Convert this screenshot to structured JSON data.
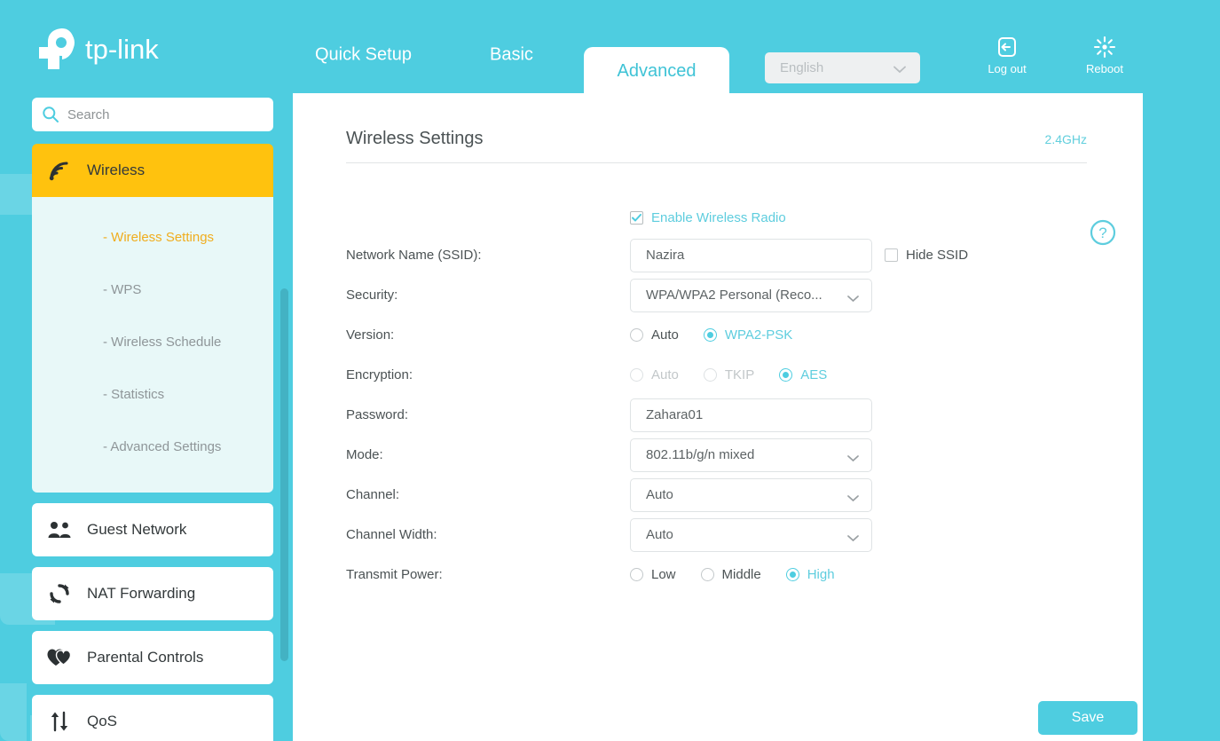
{
  "brand": {
    "name": "tp-link"
  },
  "header": {
    "tabs": [
      {
        "label": "Quick Setup",
        "active": false
      },
      {
        "label": "Basic",
        "active": false
      },
      {
        "label": "Advanced",
        "active": true
      }
    ],
    "language": {
      "value": "English"
    },
    "logout_label": "Log out",
    "reboot_label": "Reboot"
  },
  "sidebar": {
    "search_placeholder": "Search",
    "search_value": "",
    "items": [
      {
        "label": "Wireless",
        "icon": "wifi-icon",
        "active": true
      },
      {
        "label": "Guest Network",
        "icon": "guests-icon",
        "active": false
      },
      {
        "label": "NAT Forwarding",
        "icon": "refresh-icon",
        "active": false
      },
      {
        "label": "Parental Controls",
        "icon": "hearts-icon",
        "active": false
      },
      {
        "label": "QoS",
        "icon": "updown-arrows-icon",
        "active": false
      }
    ],
    "submenu": [
      {
        "label": "- Wireless Settings",
        "selected": true
      },
      {
        "label": "- WPS",
        "selected": false
      },
      {
        "label": "- Wireless Schedule",
        "selected": false
      },
      {
        "label": "- Statistics",
        "selected": false
      },
      {
        "label": "- Advanced Settings",
        "selected": false
      }
    ]
  },
  "page": {
    "title": "Wireless Settings",
    "band": "2.4GHz",
    "help_icon": "question-circle-icon"
  },
  "form": {
    "enable_radio": {
      "label": "Enable Wireless Radio",
      "checked": true
    },
    "ssid": {
      "label": "Network Name (SSID):",
      "value": "Nazira"
    },
    "hide_ssid": {
      "label": "Hide SSID",
      "checked": false
    },
    "security": {
      "label": "Security:",
      "value": "WPA/WPA2 Personal (Reco..."
    },
    "version": {
      "label": "Version:",
      "options": [
        {
          "label": "Auto",
          "selected": false,
          "disabled": false
        },
        {
          "label": "WPA2-PSK",
          "selected": true,
          "disabled": false
        }
      ]
    },
    "encryption": {
      "label": "Encryption:",
      "options": [
        {
          "label": "Auto",
          "selected": false,
          "disabled": true
        },
        {
          "label": "TKIP",
          "selected": false,
          "disabled": true
        },
        {
          "label": "AES",
          "selected": true,
          "disabled": false
        }
      ]
    },
    "password": {
      "label": "Password:",
      "value": "Zahara01"
    },
    "mode": {
      "label": "Mode:",
      "value": "802.11b/g/n mixed"
    },
    "channel": {
      "label": "Channel:",
      "value": "Auto"
    },
    "channel_width": {
      "label": "Channel Width:",
      "value": "Auto"
    },
    "transmit_power": {
      "label": "Transmit Power:",
      "options": [
        {
          "label": "Low",
          "selected": false,
          "disabled": false
        },
        {
          "label": "Middle",
          "selected": false,
          "disabled": false
        },
        {
          "label": "High",
          "selected": true,
          "disabled": false
        }
      ]
    },
    "save_label": "Save"
  },
  "colors": {
    "teal": "#4ecde0",
    "amber": "#ffc20e",
    "submenu_bg": "#e8f8f8",
    "text_dark": "#4b5254"
  }
}
